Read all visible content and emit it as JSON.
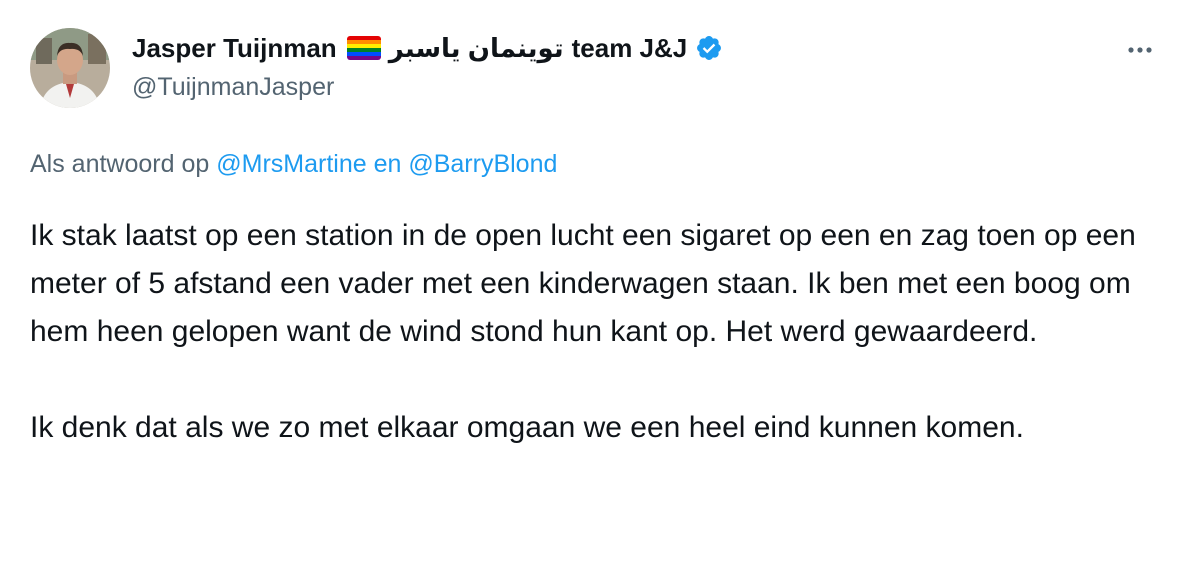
{
  "author": {
    "name_start": "Jasper Tuijnman",
    "name_arabic": "توينمان ياسبر",
    "name_end": "team J&J",
    "handle": "@TuijnmanJasper",
    "verified": true,
    "avatar_icon": "profile-photo",
    "flag_icon": "rainbow-flag-icon"
  },
  "reply": {
    "prefix": "Als antwoord op",
    "mention1": "@MrsMartine",
    "conjunction": "en",
    "mention2": "@BarryBlond"
  },
  "tweet": {
    "paragraph1": "Ik stak laatst op een station in de open lucht een sigaret op een en zag toen op een meter of 5 afstand een vader met een kinderwagen staan. Ik ben met een boog om hem heen gelopen want de wind stond hun kant op. Het werd gewaardeerd.",
    "paragraph2": "Ik denk dat als we zo met elkaar omgaan we een heel eind kunnen komen."
  },
  "colors": {
    "text": "#0f1419",
    "secondary": "#536471",
    "link": "#1d9bf0",
    "verified": "#1d9bf0"
  }
}
